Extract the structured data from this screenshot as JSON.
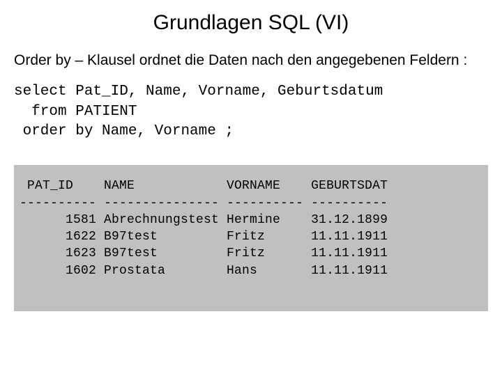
{
  "title": "Grundlagen SQL (VI)",
  "subtitle": "Order by – Klausel ordnet die Daten nach den angegebenen Feldern :",
  "sql": {
    "line1": "select Pat_ID, Name, Vorname, Geburtsdatum",
    "line2": "  from PATIENT",
    "line3": " order by Name, Vorname ;"
  },
  "output": {
    "header": " PAT_ID    NAME            VORNAME    GEBURTSDAT",
    "divider": "---------- --------------- ---------- ----------",
    "rows": [
      "      1581 Abrechnungstest Hermine    31.12.1899",
      "      1622 B97test         Fritz      11.11.1911",
      "      1623 B97test         Fritz      11.11.1911",
      "      1602 Prostata        Hans       11.11.1911"
    ]
  }
}
